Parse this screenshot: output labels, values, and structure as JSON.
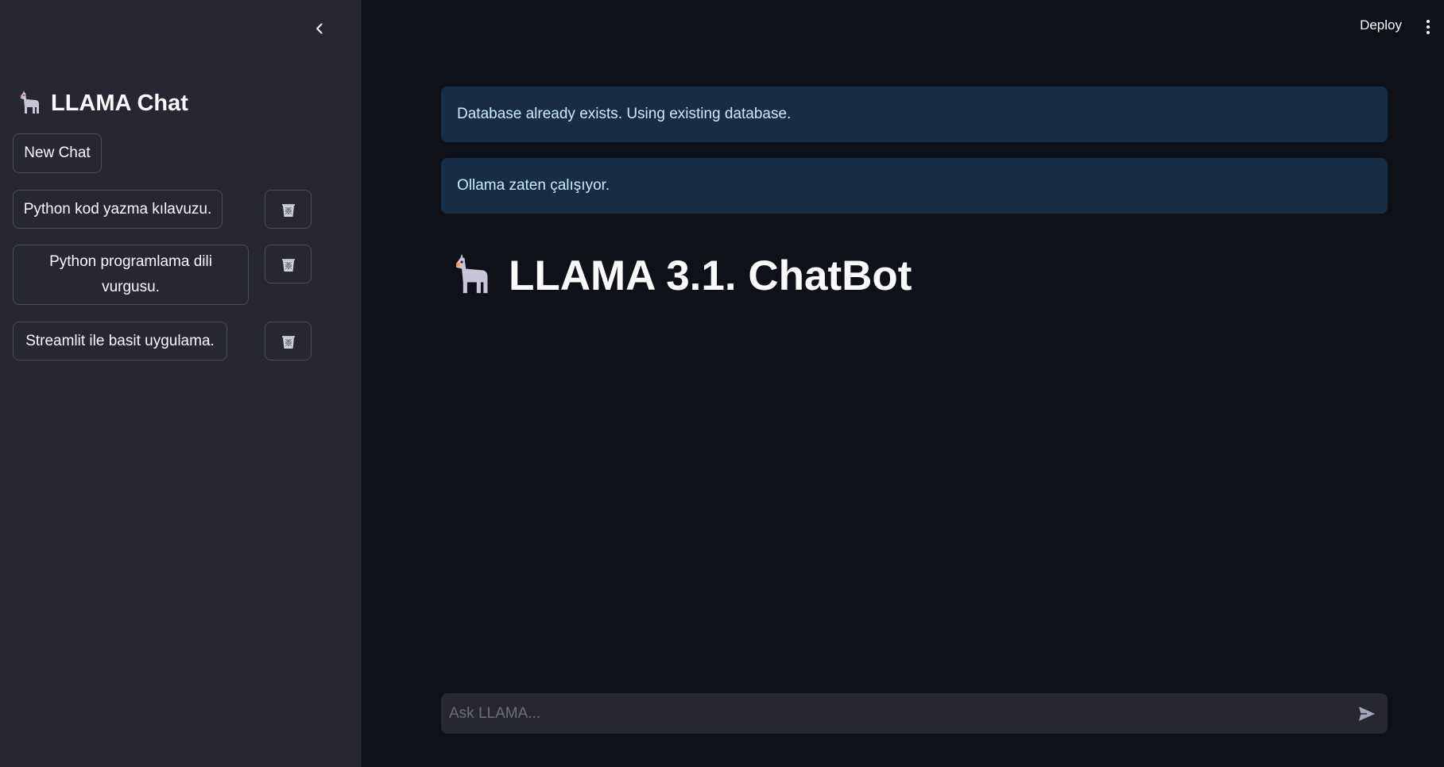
{
  "sidebar": {
    "title": "LLAMA Chat",
    "new_chat_label": "New Chat",
    "chats": [
      {
        "label": "Python kod yazma kılavuzu."
      },
      {
        "label": "Python programlama dili vurgusu."
      },
      {
        "label": "Streamlit ile basit uygulama."
      }
    ]
  },
  "header": {
    "deploy_label": "Deploy"
  },
  "main": {
    "alerts": [
      {
        "text": "Database already exists. Using existing database."
      },
      {
        "text": "Ollama zaten çalışıyor."
      }
    ],
    "title": "LLAMA 3.1. ChatBot"
  },
  "chat_input": {
    "placeholder": "Ask LLAMA..."
  },
  "colors": {
    "sidebar_bg": "#262730",
    "main_bg": "#0e1117",
    "alert_bg": "#172d43",
    "alert_text": "#c7ebff"
  },
  "icons": {
    "collapse": "chevron-left-icon",
    "llama": "llama-icon",
    "trash": "wastebasket-icon",
    "menu": "kebab-menu-icon",
    "send": "send-icon"
  }
}
